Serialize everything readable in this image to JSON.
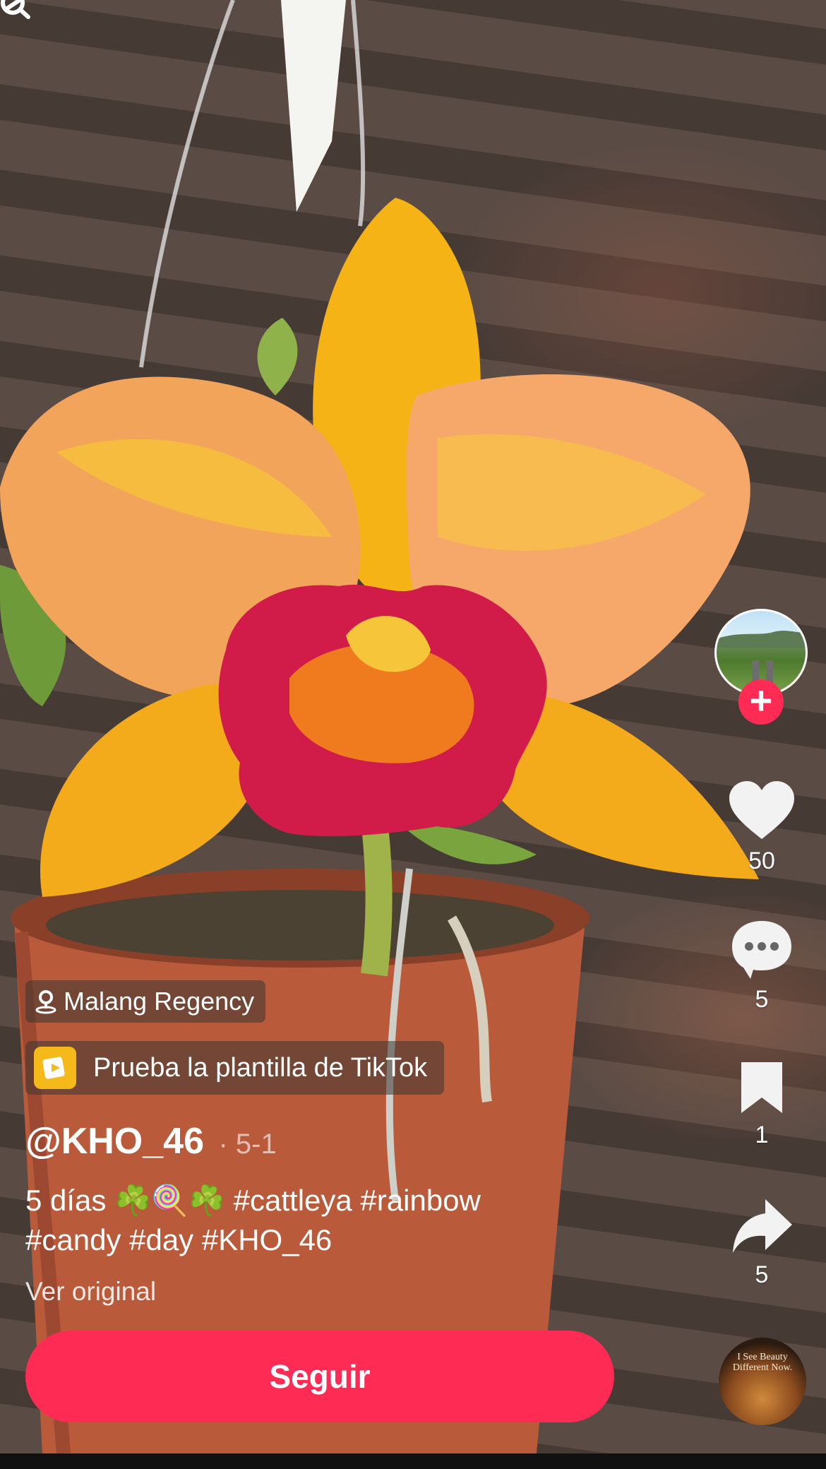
{
  "location": {
    "label": "Malang Regency",
    "icon": "location-pin-icon"
  },
  "template": {
    "label": "Prueba la plantilla de TikTok",
    "icon": "template-icon"
  },
  "author": {
    "handle": "@KHO_46",
    "date": "· 5-1"
  },
  "caption": {
    "line1": "5 días ☘️🍭☘️ #cattleya #rainbow",
    "line2": "#candy #day #KHO_46"
  },
  "see_original": "Ver original",
  "follow_button": "Seguir",
  "actions": {
    "likes": "50",
    "comments": "5",
    "saves": "1",
    "shares": "5"
  },
  "music_disc_text": "I See Beauty Different Now.",
  "colors": {
    "accent": "#fe2c55",
    "template_icon": "#f5b91a",
    "text": "#ffffff"
  }
}
